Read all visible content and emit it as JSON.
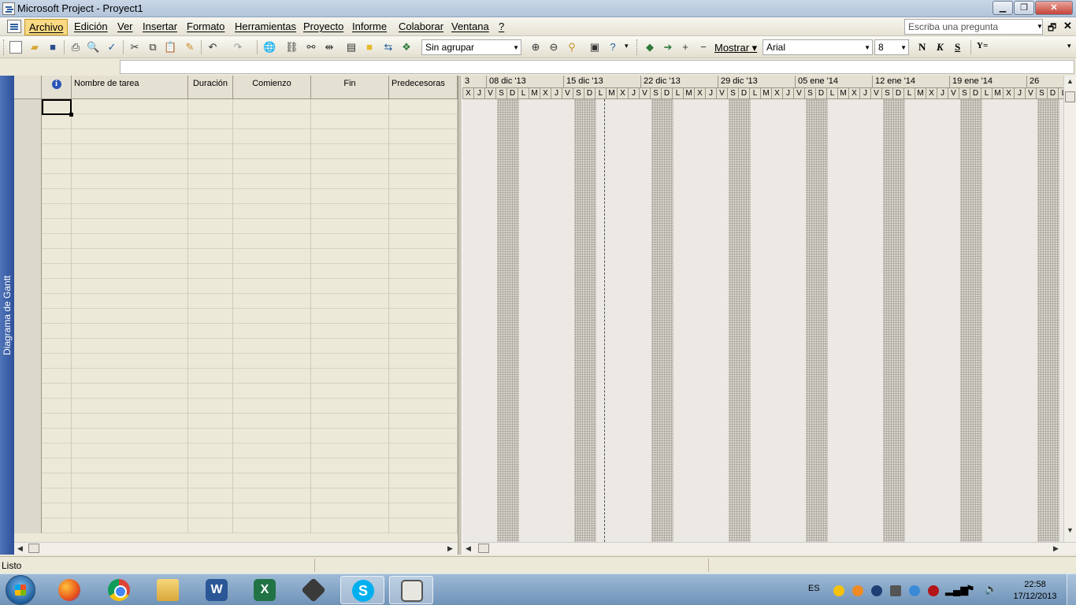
{
  "window": {
    "title": "Microsoft Project - Proyect1"
  },
  "menu": {
    "items": [
      "Archivo",
      "Edición",
      "Ver",
      "Insertar",
      "Formato",
      "Herramientas",
      "Proyecto",
      "Informe",
      "Colaborar",
      "Ventana",
      "?"
    ],
    "active_item": "Archivo",
    "ask_placeholder": "Escriba una pregunta"
  },
  "toolbar": {
    "group_combo": "Sin agrupar",
    "show_label": "Mostrar",
    "font_combo": "Arial",
    "size_combo": "8",
    "bold": "N",
    "italic": "K",
    "underline": "S",
    "filter_label": "Y="
  },
  "view_bar": {
    "label": "Diagrama de Gantt"
  },
  "table": {
    "columns": [
      "",
      "Nombre de tarea",
      "Duración",
      "Comienzo",
      "Fin",
      "Predecesoras"
    ]
  },
  "gantt": {
    "weeks": [
      "3",
      "08 dic '13",
      "15 dic '13",
      "22 dic '13",
      "29 dic '13",
      "05 ene '14",
      "12 ene '14",
      "19 ene '14",
      "26"
    ],
    "days": [
      "X",
      "J",
      "V",
      "S",
      "D",
      "L",
      "M",
      "X",
      "J",
      "V",
      "S",
      "D",
      "L",
      "M",
      "X",
      "J",
      "V",
      "S",
      "D",
      "L",
      "M",
      "X",
      "J",
      "V",
      "S",
      "D",
      "L",
      "M",
      "X",
      "J",
      "V",
      "S",
      "D",
      "L",
      "M",
      "X",
      "J",
      "V",
      "S",
      "D",
      "L",
      "M",
      "X",
      "J",
      "V",
      "S",
      "D",
      "L",
      "M",
      "X",
      "J",
      "V",
      "S",
      "D",
      "L"
    ]
  },
  "status": {
    "text": "Listo"
  },
  "taskbar": {
    "lang": "ES",
    "time": "22:58",
    "date": "17/12/2013",
    "apps": [
      "firefox-icon",
      "chrome-icon",
      "folder-icon",
      "word-icon",
      "excel-icon",
      "project-icon",
      "skype-icon",
      "msproject-icon"
    ]
  }
}
